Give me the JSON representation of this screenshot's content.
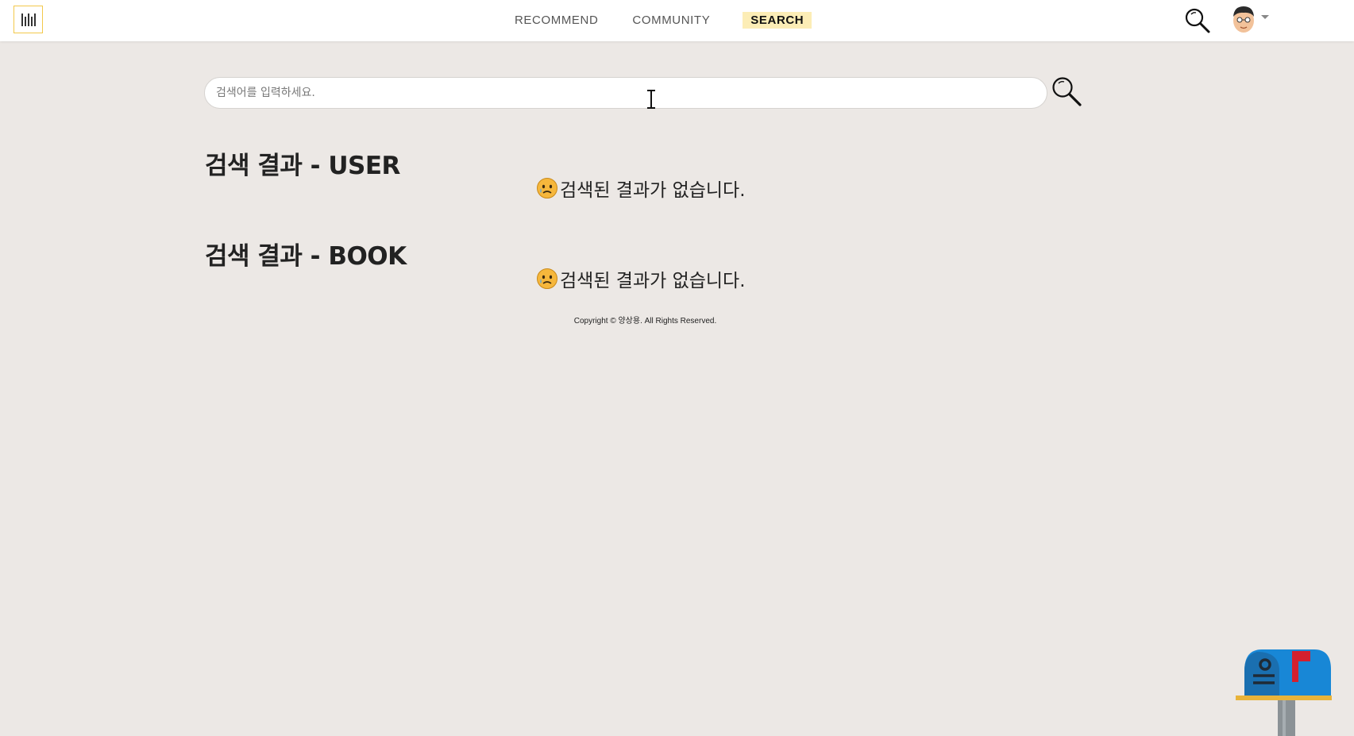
{
  "nav": {
    "links": [
      {
        "label": "RECOMMEND"
      },
      {
        "label": "COMMUNITY"
      },
      {
        "label": "SEARCH",
        "active": true
      }
    ],
    "accent_color": "#fcedb6"
  },
  "search": {
    "placeholder": "검색어를 입력하세요.",
    "value": ""
  },
  "results": {
    "user": {
      "title": "검색 결과 - USER",
      "empty_message": "검색된 결과가 없습니다."
    },
    "book": {
      "title": "검색 결과 - BOOK",
      "empty_message": "검색된 결과가 없습니다."
    }
  },
  "footer": {
    "copyright": "Copyright © 양상용. All Rights Reserved."
  },
  "icons": {
    "logo": "logo-icon",
    "nav_search": "search-icon",
    "avatar": "avatar",
    "search_button": "search-icon",
    "empty": "sad-face-icon",
    "mailbox": "mailbox-icon"
  }
}
